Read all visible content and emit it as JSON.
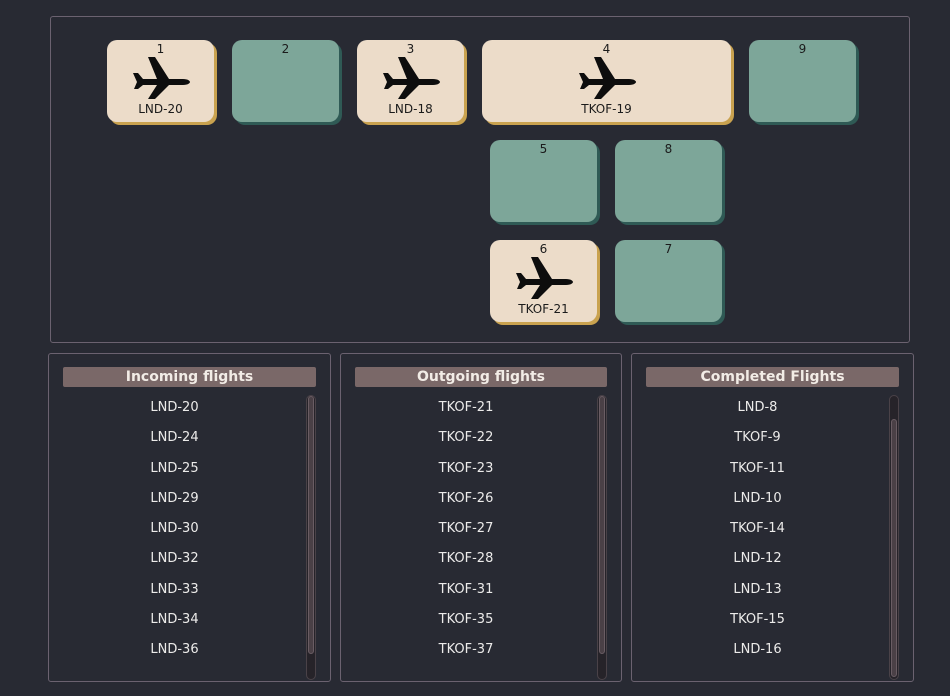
{
  "gates": [
    {
      "number": "1",
      "status": "occupied",
      "flight": "LND-20",
      "icon": "airplane-icon"
    },
    {
      "number": "2",
      "status": "empty",
      "flight": ""
    },
    {
      "number": "3",
      "status": "occupied",
      "flight": "LND-18",
      "icon": "airplane-icon"
    },
    {
      "number": "4",
      "status": "occupied",
      "flight": "TKOF-19",
      "icon": "airplane-icon"
    },
    {
      "number": "9",
      "status": "empty",
      "flight": ""
    },
    {
      "number": "5",
      "status": "empty",
      "flight": ""
    },
    {
      "number": "8",
      "status": "empty",
      "flight": ""
    },
    {
      "number": "6",
      "status": "occupied",
      "flight": "TKOF-21",
      "icon": "airplane-icon"
    },
    {
      "number": "7",
      "status": "empty",
      "flight": ""
    }
  ],
  "panels": {
    "incoming": {
      "title": "Incoming flights",
      "items": [
        "LND-20",
        "LND-24",
        "LND-25",
        "LND-29",
        "LND-30",
        "LND-32",
        "LND-33",
        "LND-34",
        "LND-36"
      ],
      "scroll_position": 0.0
    },
    "outgoing": {
      "title": "Outgoing flights",
      "items": [
        "TKOF-21",
        "TKOF-22",
        "TKOF-23",
        "TKOF-26",
        "TKOF-27",
        "TKOF-28",
        "TKOF-31",
        "TKOF-35",
        "TKOF-37"
      ],
      "scroll_position": 0.0
    },
    "completed": {
      "title": "Completed Flights",
      "items": [
        "LND-8",
        "TKOF-9",
        "TKOF-11",
        "LND-10",
        "TKOF-14",
        "LND-12",
        "LND-13",
        "TKOF-15",
        "LND-16"
      ],
      "scroll_position": 1.0
    }
  },
  "colors": {
    "background": "#282a33",
    "gate_empty": "#7da699",
    "gate_occupied": "#ecdcc9",
    "header": "#7a6868"
  }
}
